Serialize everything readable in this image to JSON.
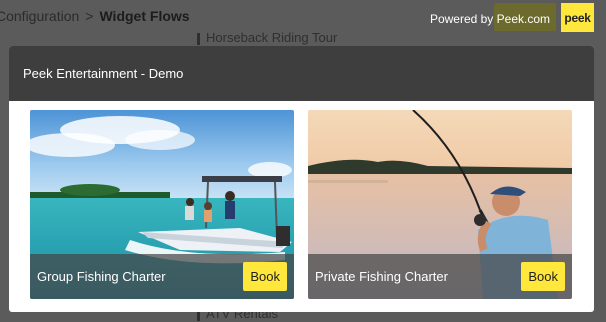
{
  "background": {
    "breadcrumb": {
      "parent": "Configuration",
      "separator": ">",
      "current": "Widget Flows"
    },
    "items": [
      "Horseback Riding Tour",
      "ATV Rentals"
    ]
  },
  "powered_by": "Powered by Peek.com",
  "logo_text": "peek",
  "modal": {
    "title": "Peek Entertainment - Demo",
    "cards": [
      {
        "title": "Group Fishing Charter",
        "button": "Book"
      },
      {
        "title": "Private Fishing Charter",
        "button": "Book"
      }
    ]
  },
  "colors": {
    "accent": "#ffe83b",
    "header": "#3e3e3e",
    "overlay": "#5b5b5b"
  }
}
